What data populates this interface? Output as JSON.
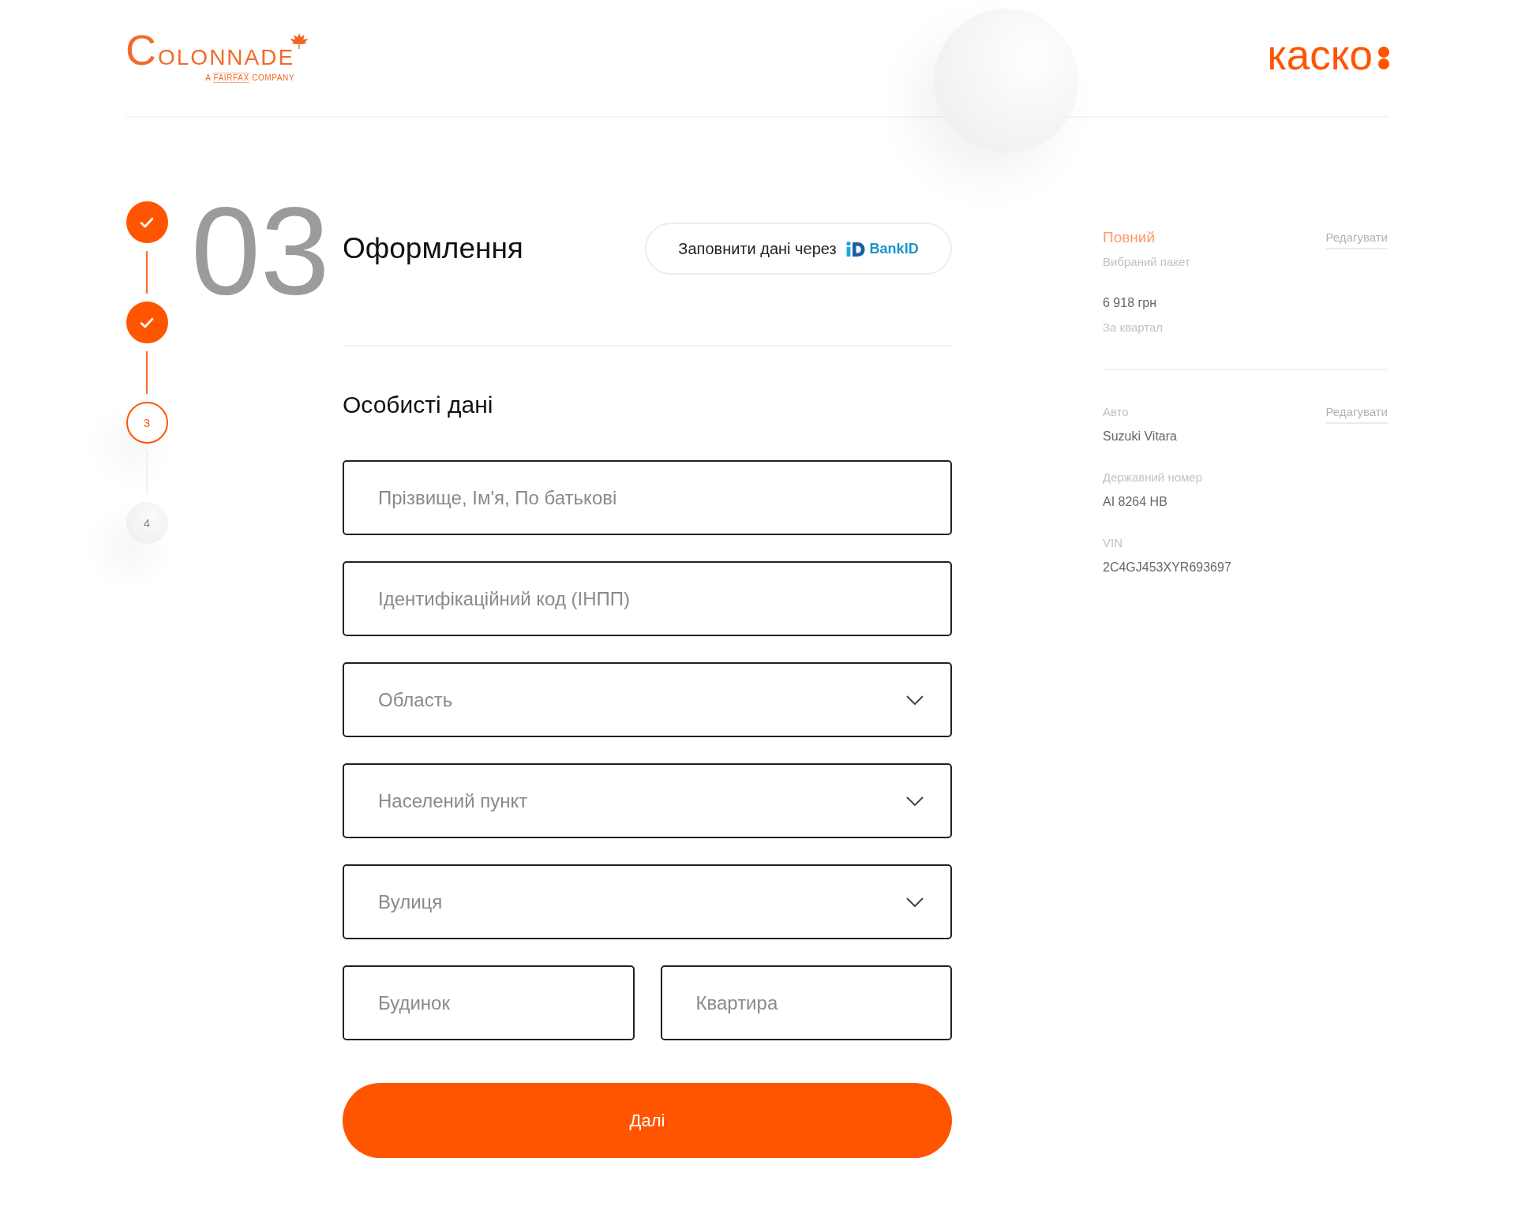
{
  "header": {
    "logo": {
      "wordmark": "COLONNADE",
      "tagline": {
        "prefix": "A",
        "brand": "FAIRFAX",
        "suffix": "COMPANY"
      }
    },
    "product_logo": {
      "wordmark": "каско"
    }
  },
  "steps": [
    {
      "completed": true,
      "selected": false
    },
    {
      "completed": true,
      "selected": false
    },
    {
      "number": "3",
      "completed": false,
      "selected": true
    },
    {
      "number": "4",
      "completed": false,
      "selected": false
    }
  ],
  "form": {
    "step_number": "03",
    "title": "Оформлення",
    "bankid_button": {
      "label": "Заповнити дані через",
      "brand": "BankID"
    },
    "section_title": "Особисті дані",
    "fields": [
      {
        "kind": "text",
        "placeholder": "Прізвище, Ім'я, По батькові"
      },
      {
        "kind": "text",
        "placeholder": "Ідентифікаційний код (ІНПП)"
      },
      {
        "kind": "select",
        "placeholder": "Область"
      },
      {
        "kind": "select",
        "placeholder": "Населений пункт"
      },
      {
        "kind": "select",
        "placeholder": "Вулиця"
      }
    ],
    "address_fields": [
      {
        "kind": "text",
        "placeholder": "Будинок"
      },
      {
        "kind": "text",
        "placeholder": "Квартира"
      }
    ],
    "submit_button": "Далі"
  },
  "summary": {
    "sections": [
      {
        "edit_link": "Редагувати",
        "entries": [
          {
            "kind": "package",
            "value": "Повний",
            "caption": "Вибраний пакет"
          },
          {
            "kind": "price",
            "value": "6 918 грн",
            "caption": "За квартал"
          }
        ]
      },
      {
        "edit_link": "Редагувати",
        "entries": [
          {
            "kind": "detail",
            "label": "Авто",
            "value": "Suzuki Vitara"
          },
          {
            "kind": "detail",
            "label": "Державний номер",
            "value": "AI 8264 HB"
          },
          {
            "kind": "detail",
            "label": "VIN",
            "value": "2C4GJ453XYR693697"
          }
        ]
      }
    ]
  }
}
